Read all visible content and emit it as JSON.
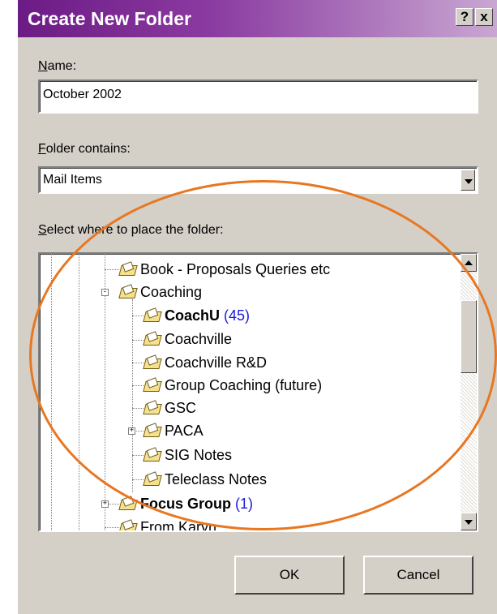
{
  "dialog": {
    "title": "Create New Folder",
    "help_button": "?",
    "close_button": "x",
    "title_gradient": [
      "#6c1b85",
      "#c9a7d2"
    ]
  },
  "name": {
    "label_accel": "N",
    "label_rest": "ame:",
    "value": "October 2002"
  },
  "folder_contains": {
    "label_accel": "F",
    "label_rest": "older contains:",
    "selected": "Mail Items"
  },
  "location": {
    "label_accel": "S",
    "label_rest": "elect where to place the folder:"
  },
  "tree": {
    "items": [
      {
        "label": "Book - Proposals Queries etc",
        "count": "",
        "bold": false,
        "icon": "folder-icon"
      },
      {
        "label": "Coaching",
        "count": "",
        "bold": false,
        "expander": "-",
        "icon": "folder-icon"
      },
      {
        "label": "CoachU",
        "count": "(45)",
        "bold": true,
        "icon": "folder-icon"
      },
      {
        "label": "Coachville",
        "count": "",
        "bold": false,
        "icon": "folder-icon"
      },
      {
        "label": "Coachville R&D",
        "count": "",
        "bold": false,
        "icon": "folder-icon"
      },
      {
        "label": "Group Coaching (future)",
        "count": "",
        "bold": false,
        "icon": "folder-icon"
      },
      {
        "label": "GSC",
        "count": "",
        "bold": false,
        "icon": "folder-icon"
      },
      {
        "label": "PACA",
        "count": "",
        "bold": false,
        "expander": "+",
        "icon": "folder-icon"
      },
      {
        "label": "SIG Notes",
        "count": "",
        "bold": false,
        "icon": "folder-icon"
      },
      {
        "label": "Teleclass Notes",
        "count": "",
        "bold": false,
        "icon": "folder-icon"
      },
      {
        "label": "Focus Group",
        "count": "(1)",
        "bold": true,
        "expander": "+",
        "icon": "folder-icon"
      },
      {
        "label": "From Karyn",
        "count": "",
        "bold": false,
        "icon": "folder-icon"
      }
    ],
    "count_color": "#1a1adb"
  },
  "buttons": {
    "ok": "OK",
    "cancel": "Cancel"
  },
  "annotation": {
    "color": "#e87722"
  }
}
